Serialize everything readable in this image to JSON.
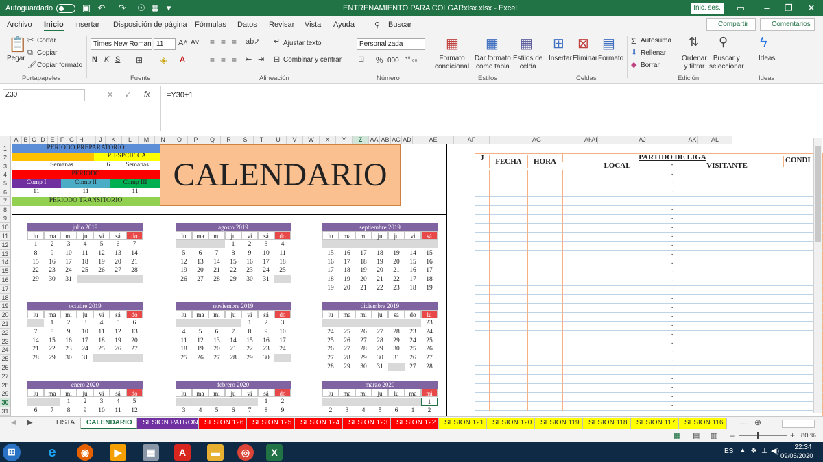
{
  "titlebar": {
    "autosave": "Autoguardado",
    "doc_title": "ENTRENAMIENTO PARA COLGARxlsx.xlsx  -  Excel",
    "signin": "Inic. ses."
  },
  "tabs": [
    "Archivo",
    "Inicio",
    "Insertar",
    "Disposición de página",
    "Fórmulas",
    "Datos",
    "Revisar",
    "Vista",
    "Ayuda"
  ],
  "search": "Buscar",
  "share": "Compartir",
  "comments": "Comentarios",
  "ribbon": {
    "cut": "Cortar",
    "copy": "Copiar",
    "paste": "Pegar",
    "copy_format": "Copiar formato",
    "font_name": "Times New Roman",
    "font_size": "11",
    "wrap_text": "Ajustar texto",
    "merge_center": "Combinar y centrar",
    "number_format": "Personalizada",
    "percent": "%",
    "thousands": "000",
    "cond_format": "Formato\ncondicional",
    "format_table": "Dar formato\ncomo tabla",
    "cell_styles": "Estilos de\ncelda",
    "insert": "Insertar",
    "delete": "Eliminar",
    "format": "Formato",
    "autosum": "Autosuma",
    "fill": "Rellenar",
    "clear": "Borrar",
    "sort_filter": "Ordenar\ny filtrar",
    "find_select": "Buscar y\nseleccionar",
    "ideas": "Ideas",
    "groups": [
      "Portapapeles",
      "Fuente",
      "Alineación",
      "Número",
      "Estilos",
      "Celdas",
      "Edición",
      "Ideas"
    ]
  },
  "formula": {
    "name_box": "Z30",
    "fx": "fx",
    "content": "=Y30+1"
  },
  "columns": [
    "A",
    "B",
    "C",
    "D",
    "E",
    "F",
    "G",
    "H",
    "I",
    "J",
    "K",
    "L",
    "M",
    "N",
    "O",
    "P",
    "Q",
    "R",
    "S",
    "T",
    "U",
    "V",
    "W",
    "X",
    "Y",
    "Z",
    "AA",
    "AB",
    "AC",
    "AD",
    "AE",
    "AF",
    "AG",
    "AH",
    "AI",
    "AJ",
    "AK",
    "AL"
  ],
  "rows": [
    "1",
    "2",
    "3",
    "4",
    "5",
    "6",
    "7",
    "8",
    "9",
    "10",
    "11",
    "12",
    "13",
    "14",
    "15",
    "16",
    "17",
    "18",
    "19",
    "20",
    "21",
    "22",
    "23",
    "24",
    "25",
    "26",
    "27",
    "28",
    "29",
    "30",
    "31"
  ],
  "periods": {
    "preparatorio": "PERIODO PREPARATORIO",
    "especifica": "P. ESPCIFICA",
    "semanas_l": "Semanas",
    "semanas_n": "6",
    "semanas_r": "Semanas",
    "periodo": "PERIODO",
    "comp1": "Comp I",
    "comp2": "Comp II",
    "comp3": "Comp III",
    "c1": "11",
    "c2": "11",
    "c3": "11",
    "transitorio": "PERIODO TRANSITORIO"
  },
  "calendar_title": "CALENDARIO",
  "weekdays": [
    "lu",
    "ma",
    "mi",
    "ju",
    "vi",
    "sá",
    "do"
  ],
  "months": [
    {
      "title": "julio  2019",
      "head": [
        "lu",
        "ma",
        "mi",
        "ju",
        "vi",
        "sá",
        "do"
      ],
      "weeks": [
        [
          "1",
          "2",
          "3",
          "4",
          "5",
          "6",
          "7"
        ],
        [
          "8",
          "9",
          "10",
          "11",
          "12",
          "13",
          "14"
        ],
        [
          "15",
          "16",
          "17",
          "18",
          "19",
          "20",
          "21"
        ],
        [
          "22",
          "23",
          "24",
          "25",
          "26",
          "27",
          "28"
        ],
        [
          "29",
          "30",
          "31",
          "",
          "",
          "",
          ""
        ]
      ]
    },
    {
      "title": "agosto  2019",
      "head": [
        "lu",
        "ma",
        "mi",
        "ju",
        "vi",
        "sá",
        "do"
      ],
      "weeks": [
        [
          "",
          "",
          "",
          "1",
          "2",
          "3",
          "4"
        ],
        [
          "5",
          "6",
          "7",
          "8",
          "9",
          "10",
          "11"
        ],
        [
          "12",
          "13",
          "14",
          "15",
          "16",
          "17",
          "18"
        ],
        [
          "19",
          "20",
          "21",
          "22",
          "23",
          "24",
          "25"
        ],
        [
          "26",
          "27",
          "28",
          "29",
          "30",
          "31",
          ""
        ]
      ]
    },
    {
      "title": "septiembre  2019",
      "head": [
        "lu",
        "ma",
        "mi",
        "ju",
        "ju",
        "vi",
        "sá"
      ],
      "weeks": [
        [
          "",
          "",
          "",
          "",
          "",
          "",
          ""
        ],
        [
          "15",
          "16",
          "17",
          "18",
          "19",
          "14",
          "15"
        ],
        [
          "16",
          "17",
          "18",
          "19",
          "20",
          "15",
          "16"
        ],
        [
          "17",
          "18",
          "19",
          "20",
          "21",
          "16",
          "17"
        ],
        [
          "18",
          "19",
          "20",
          "21",
          "22",
          "17",
          "18"
        ],
        [
          "19",
          "20",
          "21",
          "22",
          "23",
          "18",
          "19"
        ]
      ]
    },
    {
      "title": "octubre  2019",
      "head": [
        "lu",
        "ma",
        "mi",
        "ju",
        "vi",
        "sá",
        "do"
      ],
      "weeks": [
        [
          "",
          "1",
          "2",
          "3",
          "4",
          "5",
          "6"
        ],
        [
          "7",
          "8",
          "9",
          "10",
          "11",
          "12",
          "13"
        ],
        [
          "14",
          "15",
          "16",
          "17",
          "18",
          "19",
          "20"
        ],
        [
          "21",
          "22",
          "23",
          "24",
          "25",
          "26",
          "27"
        ],
        [
          "28",
          "29",
          "30",
          "31",
          "",
          "",
          ""
        ]
      ]
    },
    {
      "title": "noviembre  2019",
      "head": [
        "lu",
        "ma",
        "mi",
        "ju",
        "vi",
        "sá",
        "do"
      ],
      "weeks": [
        [
          "",
          "",
          "",
          "",
          "1",
          "2",
          "3"
        ],
        [
          "4",
          "5",
          "6",
          "7",
          "8",
          "9",
          "10"
        ],
        [
          "11",
          "12",
          "13",
          "14",
          "15",
          "16",
          "17"
        ],
        [
          "18",
          "19",
          "20",
          "21",
          "22",
          "23",
          "24"
        ],
        [
          "25",
          "26",
          "27",
          "28",
          "29",
          "30",
          ""
        ]
      ]
    },
    {
      "title": "diciembre  2019",
      "head": [
        "lu",
        "ma",
        "mi",
        "ju",
        "sá",
        "do",
        "lu"
      ],
      "weeks": [
        [
          "",
          "",
          "",
          "",
          "",
          "",
          "23"
        ],
        [
          "24",
          "25",
          "26",
          "27",
          "28",
          "23",
          "24"
        ],
        [
          "25",
          "26",
          "27",
          "28",
          "29",
          "24",
          "25"
        ],
        [
          "26",
          "27",
          "28",
          "29",
          "30",
          "25",
          "26"
        ],
        [
          "27",
          "28",
          "29",
          "30",
          "31",
          "26",
          "27"
        ],
        [
          "28",
          "29",
          "30",
          "31",
          "",
          "27",
          "28"
        ]
      ]
    },
    {
      "title": "enero  2020",
      "head": [
        "lu",
        "ma",
        "mi",
        "ju",
        "vi",
        "sá",
        "do"
      ],
      "weeks": [
        [
          "",
          "",
          "1",
          "2",
          "3",
          "4",
          "5"
        ],
        [
          "6",
          "7",
          "8",
          "9",
          "10",
          "11",
          "12"
        ]
      ]
    },
    {
      "title": "febrero  2020",
      "head": [
        "lu",
        "ma",
        "mi",
        "ju",
        "vi",
        "sá",
        "do"
      ],
      "weeks": [
        [
          "",
          "",
          "",
          "",
          "",
          "1",
          "2"
        ],
        [
          "3",
          "4",
          "5",
          "6",
          "7",
          "8",
          "9"
        ]
      ]
    },
    {
      "title": "marzo  2020",
      "head": [
        "lu",
        "ma",
        "mi",
        "ju",
        "lu",
        "ma",
        "mi"
      ],
      "weeks": [
        [
          "",
          "",
          "",
          "",
          "",
          "",
          "1"
        ],
        [
          "2",
          "3",
          "4",
          "5",
          "6",
          "1",
          "2"
        ]
      ]
    }
  ],
  "league": {
    "j": "J",
    "fecha": "FECHA",
    "hora": "HORA",
    "partido": "PARTIDO DE LIGA",
    "local": "LOCAL",
    "dash": "-",
    "visitante": "VISITANTE",
    "condi": "CONDI"
  },
  "sheets": [
    "LISTA",
    "CALENDARIO",
    "SESION PATRON",
    "SESION 126",
    "SESION 125",
    "SESION 124",
    "SESION 123",
    "SESION 122",
    "SESION 121",
    "SESION 120",
    "SESION 119",
    "SESION 118",
    "SESION 117",
    "SESION 116"
  ],
  "status": {
    "zoom": "80 %",
    "lang": "ES",
    "time": "22:34",
    "date": "09/06/2020"
  },
  "colors": {
    "excel_green": "#217346",
    "period_blue": "#5b8ed6",
    "period_yellow": "#ffff00",
    "period_orange": "#ffc000",
    "period_red": "#ff0000",
    "comp_purple": "#7030a0",
    "comp_teal": "#4bacc6",
    "comp_green": "#00b050",
    "transit_green": "#92d050",
    "calendar_bg": "#fac090",
    "cal_header": "#8064a2",
    "league_border": "#f4b183"
  }
}
